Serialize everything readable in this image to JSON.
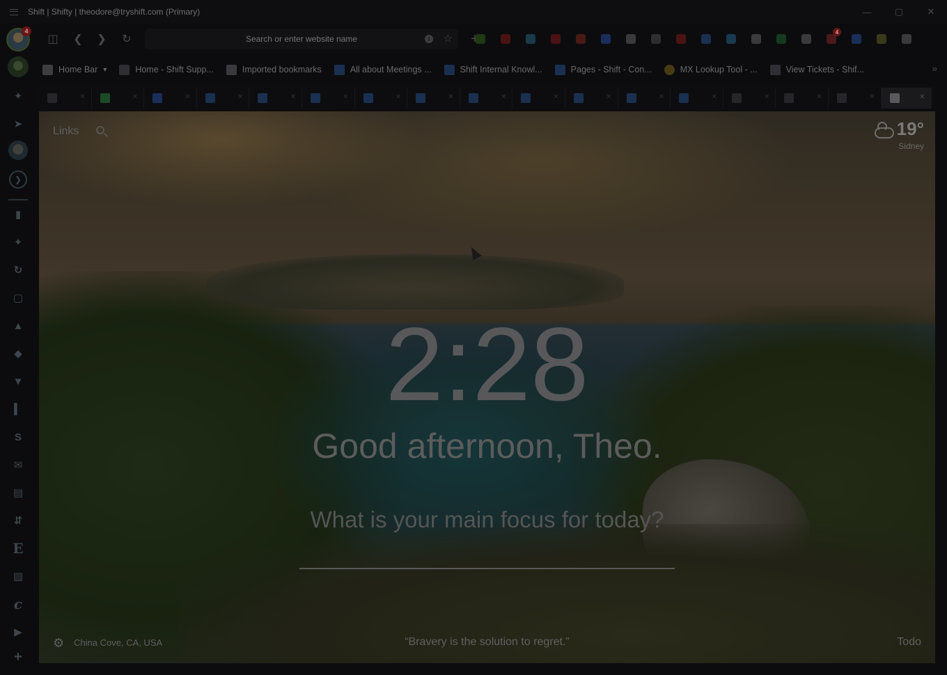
{
  "window": {
    "title": "Shift | Shifty | theodore@tryshift.com (Primary)",
    "controls": [
      "minimize-icon",
      "maximize-icon",
      "close-icon"
    ]
  },
  "rail": {
    "account_badge": "4",
    "items": [
      {
        "name": "pin-icon"
      },
      {
        "name": "rocket-icon"
      },
      {
        "name": "user-avatar"
      },
      {
        "name": "shift-app-icon"
      },
      {
        "name": "chat-icon"
      },
      {
        "name": "slack-icon"
      },
      {
        "name": "link-icon"
      },
      {
        "name": "square-icon"
      },
      {
        "name": "drive-icon"
      },
      {
        "name": "diamond-icon"
      },
      {
        "name": "book-icon"
      },
      {
        "name": "bar-chart-icon"
      },
      {
        "name": "s-icon"
      },
      {
        "name": "mail-icon"
      },
      {
        "name": "document-icon"
      },
      {
        "name": "sync-icon"
      },
      {
        "name": "e-icon"
      },
      {
        "name": "trello-icon"
      },
      {
        "name": "cursive-c-icon"
      },
      {
        "name": "youtube-icon"
      },
      {
        "name": "add-app-icon"
      }
    ]
  },
  "toolbar": {
    "search_placeholder": "Search or enter website name",
    "extensions": [
      {
        "name": "folder-ext-icon",
        "color": "#1f3a14"
      },
      {
        "name": "red-ext-icon",
        "color": "#4a1212"
      },
      {
        "name": "colorful-ext-icon",
        "color": "#1a3a4a"
      },
      {
        "name": "dots-ext-icon",
        "color": "#4a1212"
      },
      {
        "name": "stack-ext-icon",
        "color": "#4a1a14"
      },
      {
        "name": "zoom-ext-icon",
        "color": "#1a2e5a"
      },
      {
        "name": "cloud-ext-icon",
        "color": "#3a3a3a"
      },
      {
        "name": "pen-ext-icon",
        "color": "#2e2e2e"
      },
      {
        "name": "fb-ext-icon",
        "color": "#4a1212"
      },
      {
        "name": "ring-ext-icon",
        "color": "#1a3050"
      },
      {
        "name": "bolt-ext-icon",
        "color": "#1a3a50"
      },
      {
        "name": "grey-ext-icon",
        "color": "#3a3a3a"
      },
      {
        "name": "grammarly-ext-icon",
        "color": "#163a20"
      },
      {
        "name": "layers-ext-icon",
        "color": "#3a3a3a"
      },
      {
        "name": "gmail-ext-icon",
        "color": "#4a1a1a",
        "badge": "4"
      },
      {
        "name": "calendar-ext-icon",
        "color": "#1a2e5a"
      },
      {
        "name": "drive-ext-icon",
        "color": "#3a3a1a"
      },
      {
        "name": "settings-ext-icon",
        "color": "#3a3a3a"
      }
    ]
  },
  "bookmarks": [
    {
      "label": "Home Bar",
      "icon": "home-icon"
    },
    {
      "label": "Home - Shift Supp...",
      "icon": "shift-icon"
    },
    {
      "label": "Imported bookmarks",
      "icon": "folder-icon"
    },
    {
      "label": "All about Meetings ...",
      "icon": "confluence-icon"
    },
    {
      "label": "Shift Internal Knowl...",
      "icon": "diamond-icon"
    },
    {
      "label": "Pages - Shift - Con...",
      "icon": "confluence-icon"
    },
    {
      "label": "MX Lookup Tool - ...",
      "icon": "mx-icon"
    },
    {
      "label": "View Tickets - Shif...",
      "icon": "shift-icon"
    }
  ],
  "tabs": [
    {
      "icon": "shift-icon",
      "color": "#26262a"
    },
    {
      "icon": "sheets-icon",
      "color": "#1a4a26"
    },
    {
      "icon": "docs-icon",
      "color": "#1a2e5a"
    },
    {
      "icon": "confluence-icon",
      "color": "#1a3050"
    },
    {
      "icon": "confluence-icon",
      "color": "#1a3050"
    },
    {
      "icon": "confluence-icon",
      "color": "#1a3050"
    },
    {
      "icon": "confluence-icon",
      "color": "#1a3050"
    },
    {
      "icon": "confluence-icon",
      "color": "#1a3050"
    },
    {
      "icon": "confluence-icon",
      "color": "#1a3050"
    },
    {
      "icon": "confluence-icon",
      "color": "#1a3050"
    },
    {
      "icon": "confluence-icon",
      "color": "#1a3050"
    },
    {
      "icon": "confluence-icon",
      "color": "#1a3050"
    },
    {
      "icon": "confluence-icon",
      "color": "#1a3050"
    },
    {
      "icon": "shift-icon",
      "color": "#26262a"
    },
    {
      "icon": "shift-icon",
      "color": "#26262a"
    },
    {
      "icon": "shift-icon",
      "color": "#26262a"
    },
    {
      "icon": "page-icon",
      "color": "#5a5a5e",
      "active": true
    }
  ],
  "newtab": {
    "links_label": "Links",
    "weather": {
      "temp": "19°",
      "city": "Sidney"
    },
    "clock": "2:28",
    "greeting": "Good afternoon, Theo.",
    "focus_question": "What is your main focus for today?",
    "location": "China Cove, CA, USA",
    "quote": "“Bravery is the solution to regret.”",
    "todo_label": "Todo"
  }
}
